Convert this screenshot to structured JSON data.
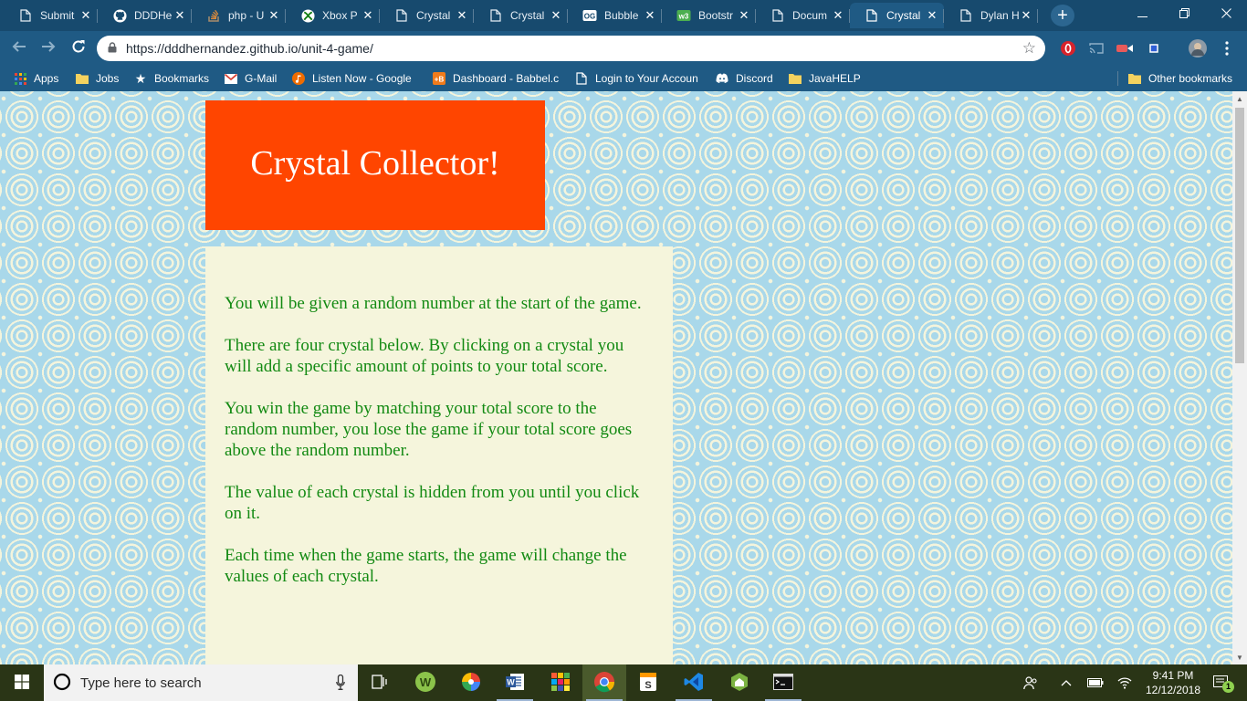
{
  "browser": {
    "tabs": [
      {
        "label": "Submit",
        "icon": "document-icon"
      },
      {
        "label": "DDDHe",
        "icon": "github-icon"
      },
      {
        "label": "php - U",
        "icon": "stackoverflow-icon"
      },
      {
        "label": "Xbox P",
        "icon": "xbox-icon"
      },
      {
        "label": "Crystal",
        "icon": "document-icon"
      },
      {
        "label": "Crystal",
        "icon": "document-icon"
      },
      {
        "label": "Bubble",
        "icon": "og-icon"
      },
      {
        "label": "Bootstr",
        "icon": "w3-icon"
      },
      {
        "label": "Docum",
        "icon": "document-icon"
      },
      {
        "label": "Crystal",
        "icon": "document-icon",
        "active": true
      },
      {
        "label": "Dylan H",
        "icon": "document-icon"
      }
    ],
    "tab_close_glyph": "✕",
    "new_tab_glyph": "+",
    "url": "https://dddhernandez.github.io/unit-4-game/",
    "bookmarks": [
      {
        "label": "Apps",
        "icon": "apps-grid-icon"
      },
      {
        "label": "Jobs",
        "icon": "folder-icon"
      },
      {
        "label": "Bookmarks",
        "icon": "star-icon"
      },
      {
        "label": "G-Mail",
        "icon": "gmail-icon"
      },
      {
        "label": "Listen Now - Google",
        "icon": "music-icon"
      },
      {
        "label": "Dashboard - Babbel.c",
        "icon": "babbel-icon"
      },
      {
        "label": "Login to Your Accoun",
        "icon": "document-icon"
      },
      {
        "label": "Discord",
        "icon": "discord-icon"
      },
      {
        "label": "JavaHELP",
        "icon": "folder-icon"
      }
    ],
    "other_bookmarks": "Other bookmarks"
  },
  "page": {
    "title": "Crystal Collector!",
    "rules": [
      "You will be given a random number at the start of the game.",
      "There are four crystal below. By clicking on a crystal you will add a specific amount of points to your total score.",
      "You win the game by matching your total score to the random number, you lose the game if your total score goes above the random number.",
      "The value of each crystal is hidden from you until you click on it.",
      "Each time when the game starts, the game will change the values of each crystal."
    ]
  },
  "taskbar": {
    "search_placeholder": "Type here to search",
    "time": "9:41 PM",
    "date": "12/12/2018",
    "notification_count": "1"
  },
  "colors": {
    "title_bg": "#ff4500",
    "rules_bg": "#f5f5dc",
    "rules_text": "#138a13",
    "page_bg": "#a9d8ea",
    "chrome_frame": "#1f5a84"
  }
}
